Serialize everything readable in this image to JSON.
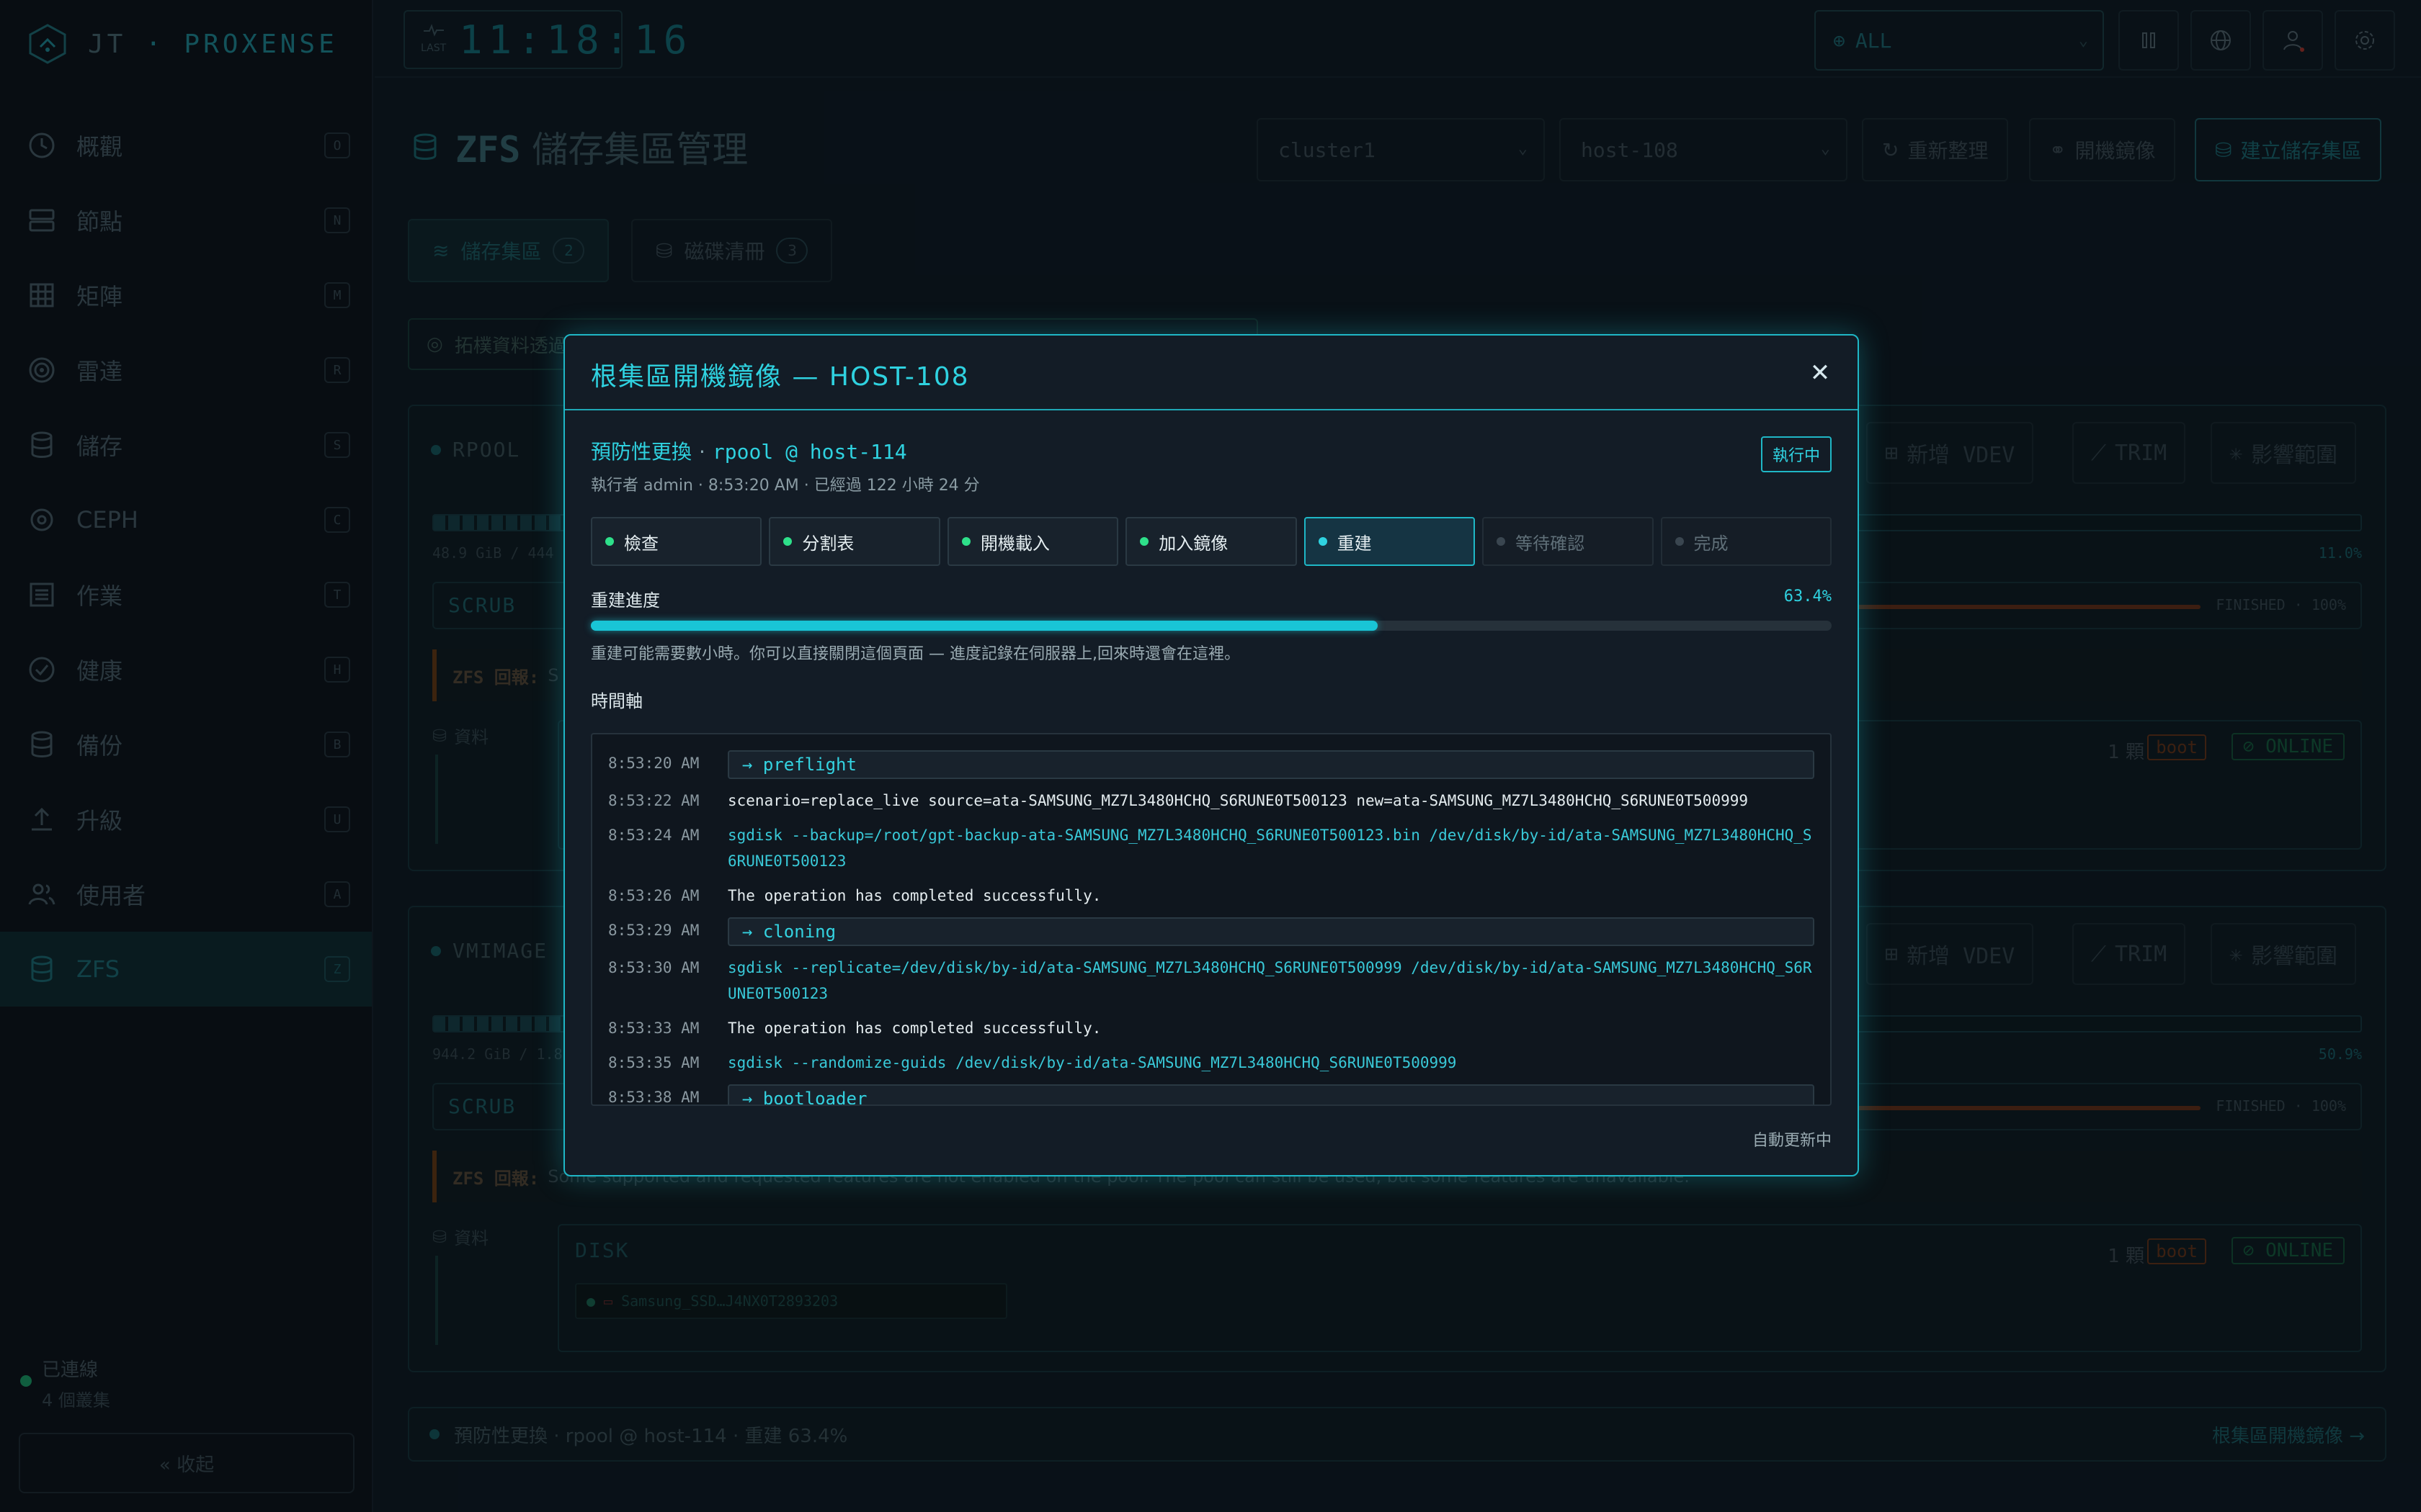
{
  "app": {
    "brand": "JT",
    "brand_sep": " · ",
    "brand_accent": "PROXENSE"
  },
  "clock": {
    "last_label": "LAST",
    "time": "11:18:16"
  },
  "top": {
    "scope_value": "ALL",
    "scope_icon": "globe-icon"
  },
  "sidebar": {
    "items": [
      {
        "label": "概觀",
        "key": "O",
        "icon": "clock-icon"
      },
      {
        "label": "節點",
        "key": "N",
        "icon": "server-icon"
      },
      {
        "label": "矩陣",
        "key": "M",
        "icon": "grid-icon"
      },
      {
        "label": "雷達",
        "key": "R",
        "icon": "radar-icon"
      },
      {
        "label": "儲存",
        "key": "S",
        "icon": "database-icon"
      },
      {
        "label": "CEPH",
        "key": "C",
        "icon": "ceph-icon"
      },
      {
        "label": "作業",
        "key": "T",
        "icon": "list-icon"
      },
      {
        "label": "健康",
        "key": "H",
        "icon": "check-circle-icon"
      },
      {
        "label": "備份",
        "key": "B",
        "icon": "database-icon"
      },
      {
        "label": "升級",
        "key": "U",
        "icon": "upload-icon"
      },
      {
        "label": "使用者",
        "key": "A",
        "icon": "users-icon"
      },
      {
        "label": "ZFS",
        "key": "Z",
        "icon": "database-icon",
        "active": true
      }
    ],
    "status_label": "已連線",
    "status_sub": "4 個叢集",
    "collapse_label": "« 收起"
  },
  "page": {
    "title_prefix": "ZFS",
    "title": "儲存集區管理",
    "cluster_select": "cluster1",
    "host_select": "host-108",
    "refresh_label": "重新整理",
    "mirror_label": "開機鏡像",
    "create_label": "建立儲存集區",
    "tabs": [
      {
        "label": "儲存集區",
        "count": "2"
      },
      {
        "label": "磁碟清冊",
        "count": "3"
      }
    ],
    "banner": "拓樸資料透過"
  },
  "pools": [
    {
      "name": "RPOOL",
      "add_vdev": "新增 VDEV",
      "trim": "TRIM",
      "impact": "影響範圍",
      "usage_text": "48.9 GiB / 444",
      "usage_pct": "11.0%",
      "usage_fraction": 0.11,
      "scrub_label": "SCRUB",
      "scrub_state": "FINISHED · 100%",
      "zfs_label": "ZFS 回報:",
      "zfs_msg": "S",
      "data_label": "資料",
      "disk_count": "1 顆",
      "boot": "boot",
      "online": "ONLINE"
    },
    {
      "name": "VMIMAGE",
      "add_vdev": "新增 VDEV",
      "trim": "TRIM",
      "impact": "影響範圍",
      "usage_text": "944.2 GiB / 1.8",
      "usage_pct": "50.9%",
      "usage_fraction": 0.509,
      "scrub_label": "SCRUB",
      "scrub_state": "FINISHED · 100%",
      "zfs_label": "ZFS 回報:",
      "zfs_msg": "Some supported and requested features are not enabled on the pool. The pool can still be used, but some features are unavailable.",
      "data_label": "資料",
      "disk_label": "DISK",
      "disk_count": "1 顆",
      "boot": "boot",
      "online": "ONLINE",
      "disk_chip": "Samsung_SSD…J4NX0T2893203"
    }
  ],
  "bottom_strip": {
    "text": "預防性更換 · rpool @ host-114 · 重建 63.4%",
    "link": "根集區開機鏡像 →"
  },
  "modal": {
    "title": "根集區開機鏡像 — HOST-108",
    "op_label": "預防性更換",
    "op_target": "rpool @ host-114",
    "meta": "執行者 admin · 8:53:20 AM · 已經過 122 小時 24 分",
    "status_badge": "執行中",
    "steps": [
      {
        "label": "檢查",
        "state": "done"
      },
      {
        "label": "分割表",
        "state": "done"
      },
      {
        "label": "開機載入",
        "state": "done"
      },
      {
        "label": "加入鏡像",
        "state": "done"
      },
      {
        "label": "重建",
        "state": "current"
      },
      {
        "label": "等待確認",
        "state": "pending"
      },
      {
        "label": "完成",
        "state": "pending"
      }
    ],
    "progress_label": "重建進度",
    "progress_pct": "63.4%",
    "progress_fraction": 0.634,
    "progress_note": "重建可能需要數小時。你可以直接關閉這個頁面 — 進度記錄在伺服器上,回來時還會在這裡。",
    "timeline_label": "時間軸",
    "timeline": [
      {
        "time": "8:53:20 AM",
        "msg": "→ preflight",
        "kind": "step"
      },
      {
        "time": "8:53:22 AM",
        "msg": "scenario=replace_live source=ata-SAMSUNG_MZ7L3480HCHQ_S6RUNE0T500123 new=ata-SAMSUNG_MZ7L3480HCHQ_S6RUNE0T500999",
        "kind": "info"
      },
      {
        "time": "8:53:24 AM",
        "msg": "sgdisk --backup=/root/gpt-backup-ata-SAMSUNG_MZ7L3480HCHQ_S6RUNE0T500123.bin /dev/disk/by-id/ata-SAMSUNG_MZ7L3480HCHQ_S6RUNE0T500123",
        "kind": "cmd"
      },
      {
        "time": "8:53:26 AM",
        "msg": "The operation has completed successfully.",
        "kind": "info"
      },
      {
        "time": "8:53:29 AM",
        "msg": "→ cloning",
        "kind": "step"
      },
      {
        "time": "8:53:30 AM",
        "msg": "sgdisk --replicate=/dev/disk/by-id/ata-SAMSUNG_MZ7L3480HCHQ_S6RUNE0T500999 /dev/disk/by-id/ata-SAMSUNG_MZ7L3480HCHQ_S6RUNE0T500123",
        "kind": "cmd"
      },
      {
        "time": "8:53:33 AM",
        "msg": "The operation has completed successfully.",
        "kind": "info"
      },
      {
        "time": "8:53:35 AM",
        "msg": "sgdisk --randomize-guids /dev/disk/by-id/ata-SAMSUNG_MZ7L3480HCHQ_S6RUNE0T500999",
        "kind": "cmd"
      },
      {
        "time": "8:53:38 AM",
        "msg": "→ bootloader",
        "kind": "step"
      }
    ],
    "footer": "自動更新中"
  }
}
